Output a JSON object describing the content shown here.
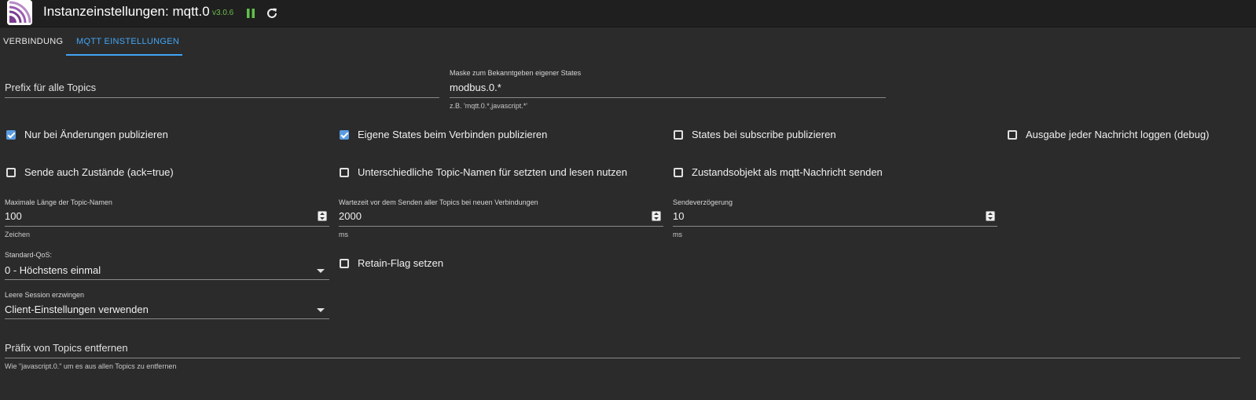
{
  "header": {
    "title": "Instanzeinstellungen: mqtt.0",
    "version": "v3.0.6",
    "accent": "#42a5f5",
    "pause_icon": "pause-icon",
    "reload_icon": "reload-icon"
  },
  "tabs": [
    {
      "label": "VERBINDUNG",
      "active": false
    },
    {
      "label": "MQTT EINSTELLUNGEN",
      "active": true
    }
  ],
  "form": {
    "prefix": {
      "placeholder": "Prefix für alle Topics",
      "value": ""
    },
    "mask": {
      "label": "Maske zum Bekanntgeben eigener States",
      "value": "modbus.0.*",
      "helper": "z.B. 'mqtt.0.*,javascript.*'"
    },
    "checkboxes": [
      {
        "label": "Nur bei Änderungen publizieren",
        "checked": true
      },
      {
        "label": "Eigene States beim Verbinden publizieren",
        "checked": true
      },
      {
        "label": "States bei subscribe publizieren",
        "checked": false
      },
      {
        "label": "Ausgabe jeder Nachricht loggen (debug)",
        "checked": false
      },
      {
        "label": "Sende auch Zustände (ack=true)",
        "checked": false
      },
      {
        "label": "Unterschiedliche Topic-Namen für setzten und lesen nutzen",
        "checked": false
      },
      {
        "label": "Zustandsobjekt als mqtt-Nachricht senden",
        "checked": false
      },
      {
        "label": "Retain-Flag setzen",
        "checked": false
      }
    ],
    "max_topic_length": {
      "label": "Maximale Länge der Topic-Namen",
      "value": "100",
      "helper": "Zeichen"
    },
    "wait_time": {
      "label": "Wartezeit vor dem Senden aller Topics bei neuen Verbindungen",
      "value": "2000",
      "helper": "ms"
    },
    "send_delay": {
      "label": "Sendeverzögerung",
      "value": "10",
      "helper": "ms"
    },
    "qos": {
      "label": "Standard-QoS:",
      "value": "0 - Höchstens einmal"
    },
    "clean_session": {
      "label": "Leere Session erzwingen",
      "value": "Client-Einstellungen verwenden"
    },
    "remove_prefix": {
      "placeholder": "Präfix von Topics entfernen",
      "value": "",
      "helper": "Wie \"javascript.0.\" um es aus allen Topics zu entfernen"
    }
  }
}
